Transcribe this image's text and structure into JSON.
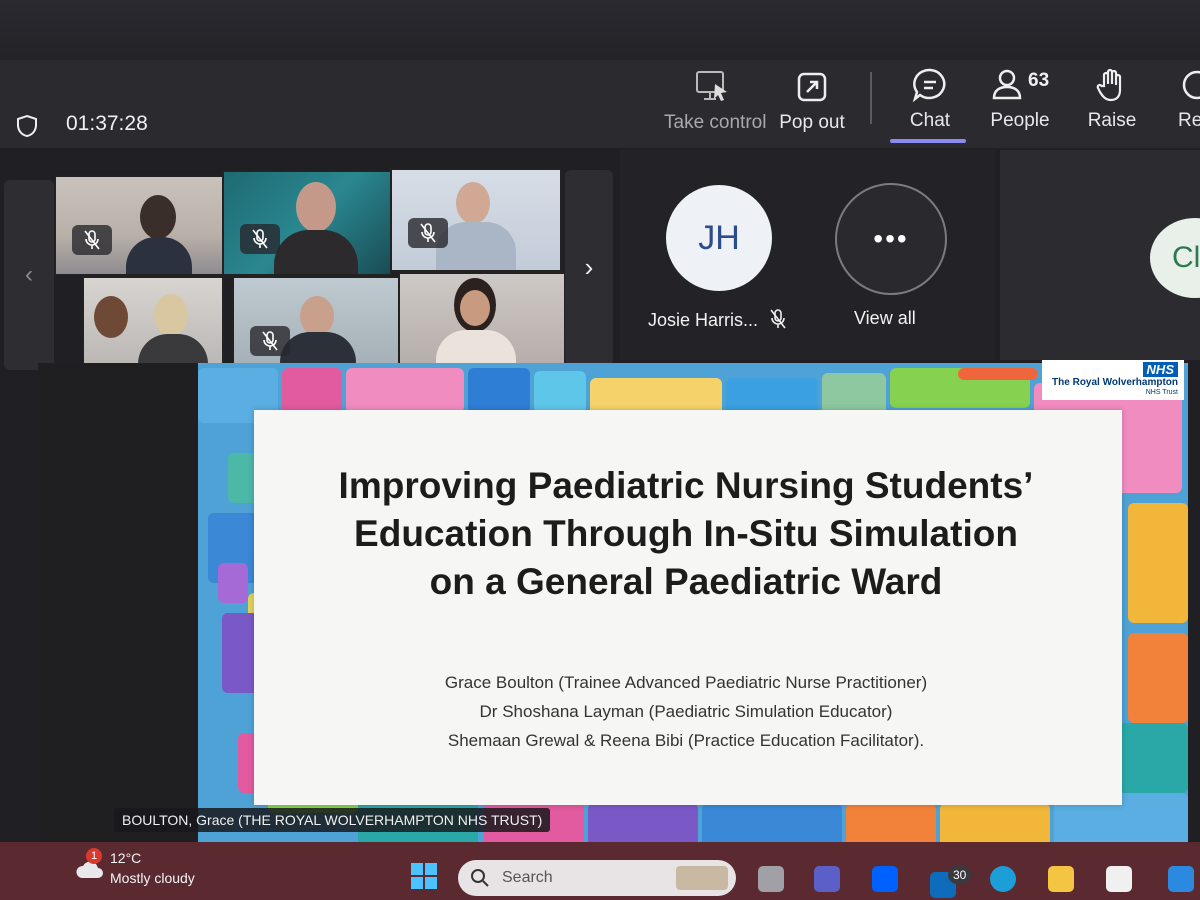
{
  "toolbar": {
    "timer": "01:37:28",
    "take_control": "Take control",
    "pop_out": "Pop out",
    "chat": "Chat",
    "people": "People",
    "people_count": "63",
    "raise": "Raise",
    "truncated_next": "Re"
  },
  "gallery": {
    "participant_initials": "JH",
    "participant_name": "Josie Harris...",
    "view_all": "View all",
    "partial_initials": "Cl"
  },
  "slide": {
    "title_line1": "Improving Paediatric Nursing Students’",
    "title_line2": "Education Through In-Situ Simulation",
    "title_line3": "on a General Paediatric Ward",
    "author1": "Grace Boulton (Trainee Advanced Paediatric Nurse Practitioner)",
    "author2": "Dr Shoshana Layman (Paediatric Simulation Educator)",
    "author3": "Shemaan Grewal & Reena Bibi (Practice Education Facilitator).",
    "nhs_logo": "NHS",
    "nhs_trust": "The Royal Wolverhampton",
    "nhs_sub": "NHS Trust"
  },
  "speaker_label": "BOULTON, Grace (THE ROYAL WOLVERHAMPTON NHS TRUST)",
  "taskbar": {
    "weather_badge": "1",
    "temperature": "12°C",
    "condition": "Mostly cloudy",
    "search_label": "Search",
    "mail_badge": "30"
  }
}
